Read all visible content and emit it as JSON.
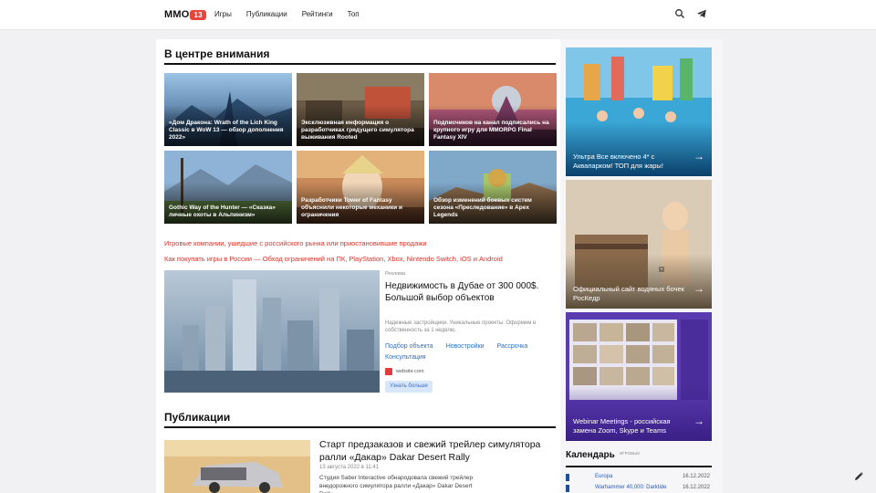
{
  "header": {
    "logo_text": "MMO",
    "logo_badge": "13",
    "nav": [
      "Игры",
      "Публикации",
      "Рейтинги",
      "Топ"
    ],
    "icons": [
      "search-icon",
      "telegram-icon"
    ]
  },
  "spotlight": {
    "title": "В центре внимания",
    "tiles": [
      {
        "caption": "«Дом Дракона: Wrath of the Lich King Classic в WoW 13 — обзор дополнения 2022»"
      },
      {
        "caption": "Эксклюзивная информация о разработчиках грядущего симулятора выживания Rooted"
      },
      {
        "caption": "Подписчиков на канал подписались на крупного игру для MMORPG Final Fantasy XIV"
      },
      {
        "caption": "Gothic Way of the Hunter — «Сказка» личные охоты в Альпинизм»"
      },
      {
        "caption": "Разработчики Tower of Fantasy объяснили некоторые механики и ограничения"
      },
      {
        "caption": "Обзор изменений боевых систем сезона «Преследование» в Apex Legends"
      }
    ]
  },
  "news_links": [
    "Игровые компании, ушедшие с российского рынка или приостановившие продажи",
    "Как покупать игры в России — Обход ограничений на ПК, PlayStation, Xbox, Nintendo Switch, iOS и Android"
  ],
  "ad": {
    "source": "Реклама",
    "title": "Недвижимость в Дубае от 300 000$. Большой выбор объектов",
    "description": "Надежные застройщики. Уникальные проекты. Оформим в собственность за 1 неделю.",
    "links": [
      "Подбор объекта",
      "Новостройки",
      "Рассрочка",
      "Консультация"
    ],
    "domain": "website.com",
    "button": "Узнать больше"
  },
  "publications": {
    "title": "Публикации",
    "item": {
      "title": "Старт предзаказов и свежий трейлер симулятора ралли «Дакар» Dakar Desert Rally",
      "date": "13 августа 2022 в 11:41",
      "text": "Студия Saber Interactive обнародовала свежий трейлер внедорожного симулятора ралли «Дакар» Dakar Desert Rally"
    }
  },
  "sidebar": {
    "cards": [
      {
        "caption": "Ультра Все включено 4* с Аквапарком! ТОП для жары!",
        "colors": [
          "#2f8fc2",
          "#0a3f6b"
        ]
      },
      {
        "caption": "Официальный сайт водяных бочек РосКедр",
        "colors": [
          "#d9cbb5",
          "#5a4a38"
        ]
      },
      {
        "caption": "Webinar Meetings - российская замена Zoom, Skype и Teams",
        "colors": [
          "#5b3bb0",
          "#3a1f86"
        ]
      }
    ],
    "calendar": {
      "title": "Календарь",
      "sup": "ИГРОВЫХ",
      "rows": [
        {
          "name": "Europa",
          "date": "16.12.2022"
        },
        {
          "name": "Warhammer 40,000: Darktide",
          "date": "16.12.2022"
        }
      ]
    }
  },
  "corner_icon": "edit-icon"
}
